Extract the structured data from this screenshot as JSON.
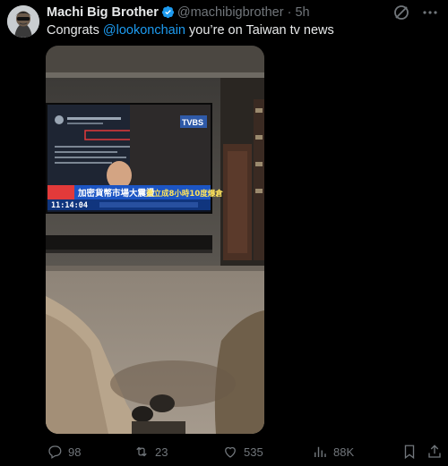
{
  "author": {
    "name": "Machi Big Brother",
    "handle": "@machibigbrother",
    "separator": "·",
    "time": "5h"
  },
  "tweet": {
    "prefix": "Congrats ",
    "mention": "@lookonchain",
    "suffix": " you’re on Taiwan tv news"
  },
  "tv": {
    "account_name": "Lookonchain",
    "ticker_prefix": "加密貨幣市場大震盪",
    "ticker_main": "黃立成8小時10度爆倉",
    "clock": "11:14:04",
    "brand": "TVBS"
  },
  "actions": {
    "replies": "98",
    "reposts": "23",
    "likes": "535",
    "views": "88K"
  },
  "icons": {
    "verified": "verified-badge-icon",
    "grok": "grok-icon",
    "more": "more-icon",
    "reply": "reply-icon",
    "repost": "repost-icon",
    "like": "like-icon",
    "views": "views-icon",
    "bookmark": "bookmark-icon",
    "share": "share-icon"
  },
  "colors": {
    "accent": "#1d9bf0",
    "muted": "#71767b",
    "text": "#e7e9ea",
    "background": "#000000"
  }
}
